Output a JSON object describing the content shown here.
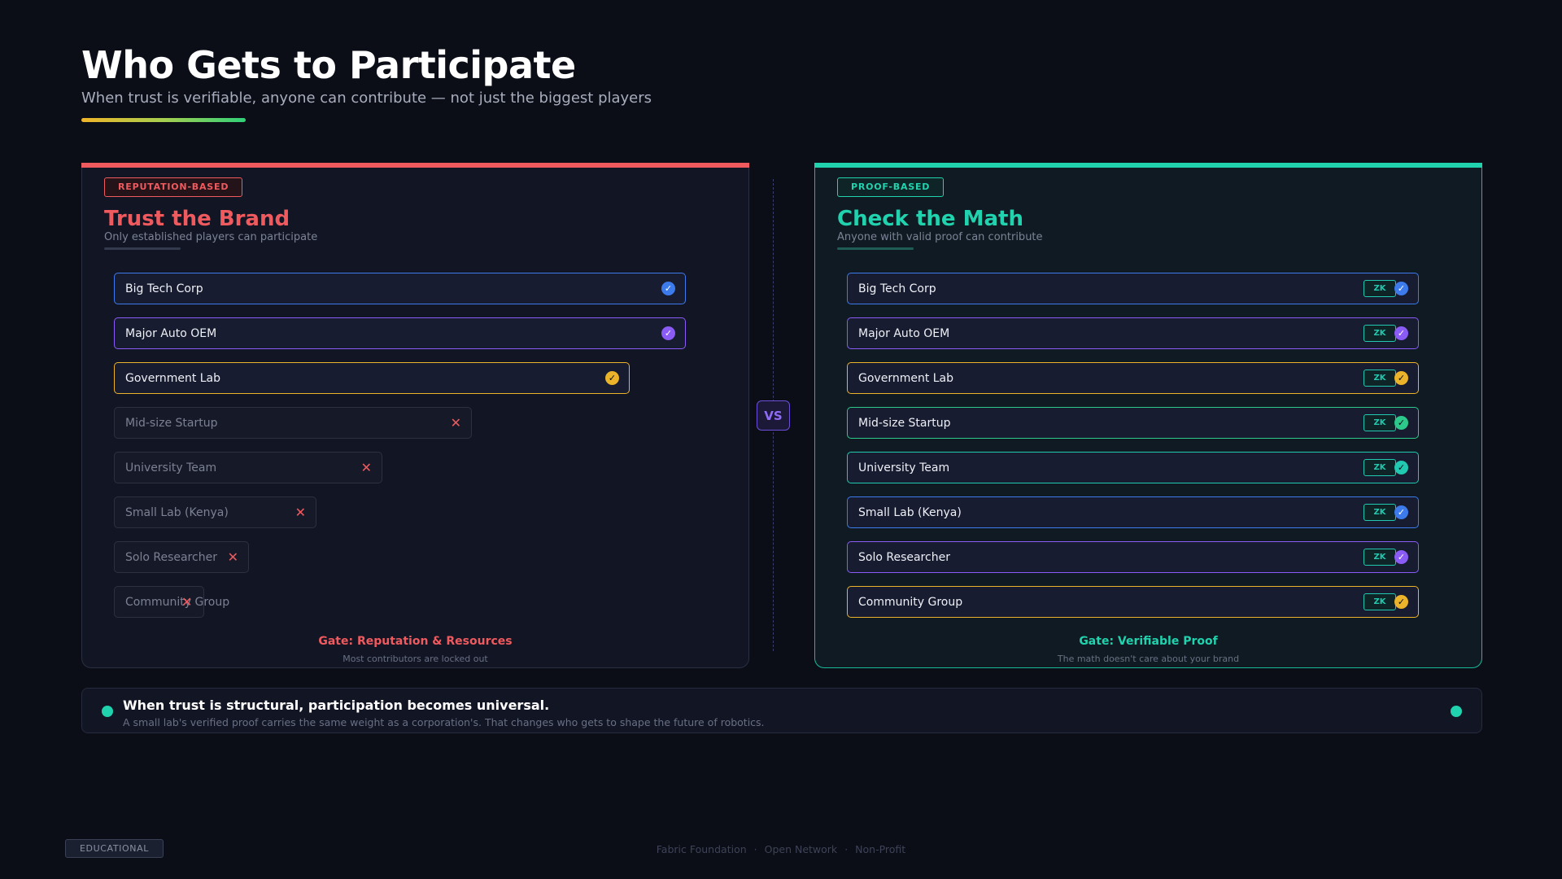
{
  "header": {
    "title": "Who Gets to Participate",
    "subtitle": "When trust is verifiable, anyone can contribute — not just the biggest players"
  },
  "left": {
    "badge": "REPUTATION-BASED",
    "title": "Trust the Brand",
    "description": "Only established players can participate",
    "gate": "Gate: Reputation & Resources",
    "gate_note": "Most contributors are locked out",
    "items": [
      {
        "name": "Big Tech Corp",
        "status": "allowed"
      },
      {
        "name": "Major Auto OEM",
        "status": "allowed"
      },
      {
        "name": "Government Lab",
        "status": "allowed"
      },
      {
        "name": "Mid-size Startup",
        "status": "blocked"
      },
      {
        "name": "University Team",
        "status": "blocked"
      },
      {
        "name": "Small Lab (Kenya)",
        "status": "blocked"
      },
      {
        "name": "Solo Researcher",
        "status": "blocked"
      },
      {
        "name": "Community Group",
        "status": "blocked"
      }
    ]
  },
  "vs_label": "VS",
  "right": {
    "badge": "PROOF-BASED",
    "title": "Check the Math",
    "description": "Anyone with valid proof can contribute",
    "gate": "Gate: Verifiable Proof",
    "gate_note": "The math doesn't care about your brand",
    "proof_label": "ZK",
    "items": [
      {
        "name": "Big Tech Corp"
      },
      {
        "name": "Major Auto OEM"
      },
      {
        "name": "Government Lab"
      },
      {
        "name": "Mid-size Startup"
      },
      {
        "name": "University Team"
      },
      {
        "name": "Small Lab (Kenya)"
      },
      {
        "name": "Solo Researcher"
      },
      {
        "name": "Community Group"
      }
    ]
  },
  "banner": {
    "title": "When trust is structural, participation becomes universal.",
    "text": "A small lab's verified proof carries the same weight as a corporation's. That changes who gets to shape the future of robotics."
  },
  "tag": "EDUCATIONAL",
  "footer": {
    "org": "Fabric Foundation",
    "network": "Open Network",
    "type": "Non-Profit"
  },
  "colors": {
    "accent_red": "#ef5a5f",
    "accent_teal": "#20d3ae",
    "blue": "#3d7bec",
    "purple": "#8a5cf5",
    "amber": "#eab32a",
    "green": "#2cc98a"
  }
}
